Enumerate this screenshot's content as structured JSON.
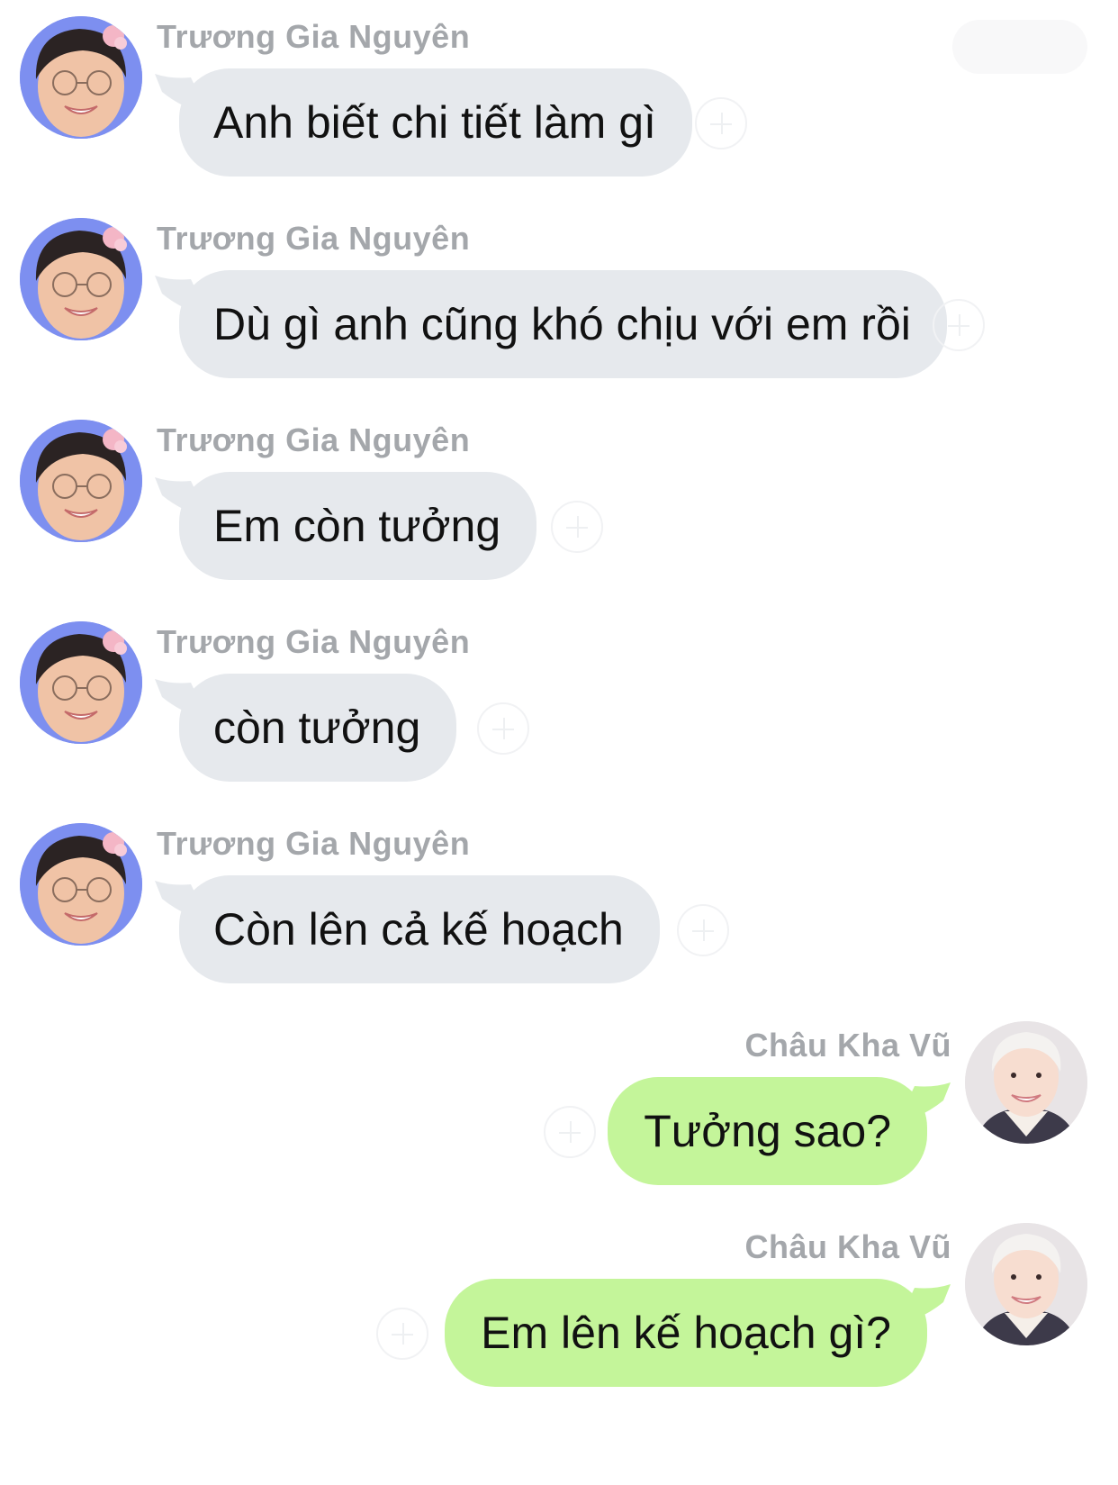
{
  "chat": {
    "messages": [
      {
        "direction": "incoming",
        "sender": "Trương Gia Nguyên",
        "text": "Anh biết chi tiết làm gì"
      },
      {
        "direction": "incoming",
        "sender": "Trương Gia Nguyên",
        "text": "Dù gì anh cũng khó chịu với em rồi"
      },
      {
        "direction": "incoming",
        "sender": "Trương Gia Nguyên",
        "text": "Em còn tưởng"
      },
      {
        "direction": "incoming",
        "sender": "Trương Gia Nguyên",
        "text": "còn tưởng"
      },
      {
        "direction": "incoming",
        "sender": "Trương Gia Nguyên",
        "text": "Còn lên cả kế hoạch"
      },
      {
        "direction": "outgoing",
        "sender": "Châu Kha Vũ",
        "text": "Tưởng sao?"
      },
      {
        "direction": "outgoing",
        "sender": "Châu Kha Vũ",
        "text": "Em lên kế hoạch gì?"
      }
    ]
  },
  "colors": {
    "incoming_bubble": "#e6e9ed",
    "outgoing_bubble": "#c4f59a",
    "sender_name": "#a4a7ab",
    "message_text": "#111111"
  },
  "icons": {
    "reaction": "add-reaction-icon",
    "incoming_avatar": "avatar-with-glasses",
    "outgoing_avatar": "avatar-light-hair"
  }
}
